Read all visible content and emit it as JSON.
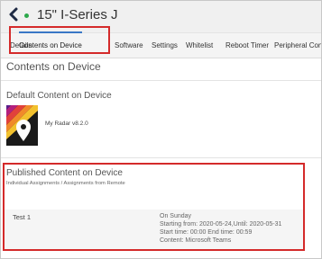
{
  "header": {
    "title": "15\" I-Series J"
  },
  "tabs": [
    {
      "label": "Details"
    },
    {
      "label": "Contents on Device"
    },
    {
      "label": "Software"
    },
    {
      "label": "Settings"
    },
    {
      "label": "Whitelist"
    },
    {
      "label": "Reboot Timer"
    },
    {
      "label": "Peripheral Con"
    }
  ],
  "page": {
    "heading": "Contents on Device"
  },
  "default_content": {
    "heading": "Default Content on Device",
    "app_name": "My Radar v8.2.0"
  },
  "published_content": {
    "heading": "Published Content on Device",
    "subheading": "Individual Assignments / Assignments from Remote",
    "item": {
      "name": "Test 1",
      "details": [
        "On Sunday",
        "Starting from: 2020-05-24,Until: 2020-05-31",
        "Start time: 00:00 End time: 00:59",
        "Content: Microsoft Teams"
      ]
    }
  },
  "colors": {
    "accent_tab": "#3a78c6",
    "highlight_box": "#d42a2a",
    "status_dot": "#2ca84a"
  },
  "icons": {
    "back": "chevron-left-icon",
    "status": "status-dot-icon",
    "app": "map-pin-icon"
  }
}
